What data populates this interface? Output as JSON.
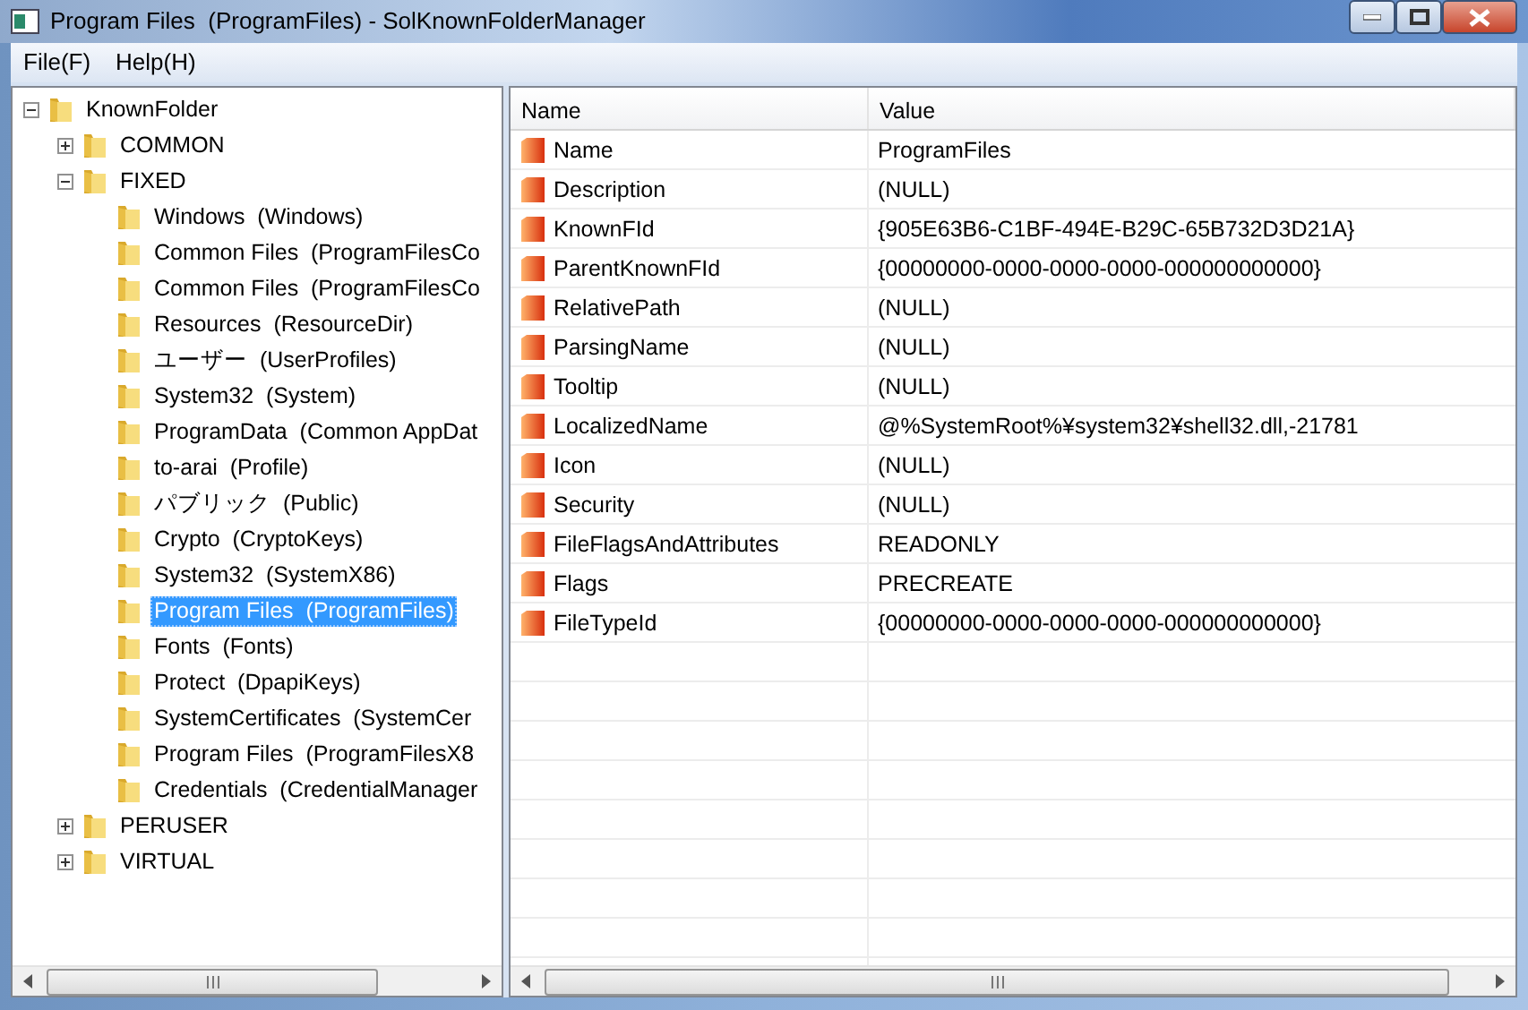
{
  "window": {
    "title": "Program Files  (ProgramFiles) - SolKnownFolderManager"
  },
  "menu": [
    "File(F)",
    "Help(H)"
  ],
  "tree": [
    {
      "label": "KnownFolder",
      "expanded": true,
      "selected": false,
      "children": [
        {
          "label": "COMMON",
          "expanded": false,
          "selected": false
        },
        {
          "label": "FIXED",
          "expanded": true,
          "selected": false,
          "children": [
            {
              "label": "Windows  (Windows)",
              "selected": false
            },
            {
              "label": "Common Files  (ProgramFilesCo",
              "selected": false
            },
            {
              "label": "Common Files  (ProgramFilesCo",
              "selected": false
            },
            {
              "label": "Resources  (ResourceDir)",
              "selected": false
            },
            {
              "label": "ユーザー  (UserProfiles)",
              "selected": false
            },
            {
              "label": "System32  (System)",
              "selected": false
            },
            {
              "label": "ProgramData  (Common AppDat",
              "selected": false
            },
            {
              "label": "to-arai  (Profile)",
              "selected": false
            },
            {
              "label": "パブリック  (Public)",
              "selected": false
            },
            {
              "label": "Crypto  (CryptoKeys)",
              "selected": false
            },
            {
              "label": "System32  (SystemX86)",
              "selected": false
            },
            {
              "label": "Program Files  (ProgramFiles)",
              "selected": true
            },
            {
              "label": "Fonts  (Fonts)",
              "selected": false
            },
            {
              "label": "Protect  (DpapiKeys)",
              "selected": false
            },
            {
              "label": "SystemCertificates  (SystemCer",
              "selected": false
            },
            {
              "label": "Program Files  (ProgramFilesX8",
              "selected": false
            },
            {
              "label": "Credentials  (CredentialManager",
              "selected": false
            }
          ]
        },
        {
          "label": "PERUSER",
          "expanded": false,
          "selected": false
        },
        {
          "label": "VIRTUAL",
          "expanded": false,
          "selected": false
        }
      ]
    }
  ],
  "table": {
    "columns": [
      "Name",
      "Value"
    ],
    "rows": [
      {
        "name": "Name",
        "value": "ProgramFiles"
      },
      {
        "name": "Description",
        "value": "(NULL)"
      },
      {
        "name": "KnownFId",
        "value": "{905E63B6-C1BF-494E-B29C-65B732D3D21A}"
      },
      {
        "name": "ParentKnownFId",
        "value": "{00000000-0000-0000-0000-000000000000}"
      },
      {
        "name": "RelativePath",
        "value": "(NULL)"
      },
      {
        "name": "ParsingName",
        "value": "(NULL)"
      },
      {
        "name": "Tooltip",
        "value": "(NULL)"
      },
      {
        "name": "LocalizedName",
        "value": "@%SystemRoot%¥system32¥shell32.dll,-21781"
      },
      {
        "name": "Icon",
        "value": "(NULL)"
      },
      {
        "name": "Security",
        "value": "(NULL)"
      },
      {
        "name": "FileFlagsAndAttributes",
        "value": "READONLY"
      },
      {
        "name": "Flags",
        "value": "PRECREATE"
      },
      {
        "name": "FileTypeId",
        "value": "{00000000-0000-0000-0000-000000000000}"
      }
    ]
  }
}
